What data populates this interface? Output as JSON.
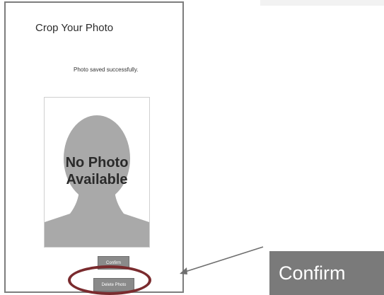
{
  "dialog": {
    "title": "Crop Your Photo",
    "status_message": "Photo saved successfully.",
    "placeholder": {
      "line1": "No Photo",
      "line2": "Available"
    },
    "confirm_label": "Confirm",
    "delete_label": "Delete Photo"
  },
  "callout": {
    "label": "Confirm"
  },
  "colors": {
    "highlight": "#7a2b2e",
    "button": "#8a8a8a",
    "callout_button": "#7a7a7a",
    "silhouette": "#a9a9a9"
  },
  "icons": {
    "placeholder_image": "person-silhouette-icon",
    "pointer": "arrow-left-icon"
  }
}
